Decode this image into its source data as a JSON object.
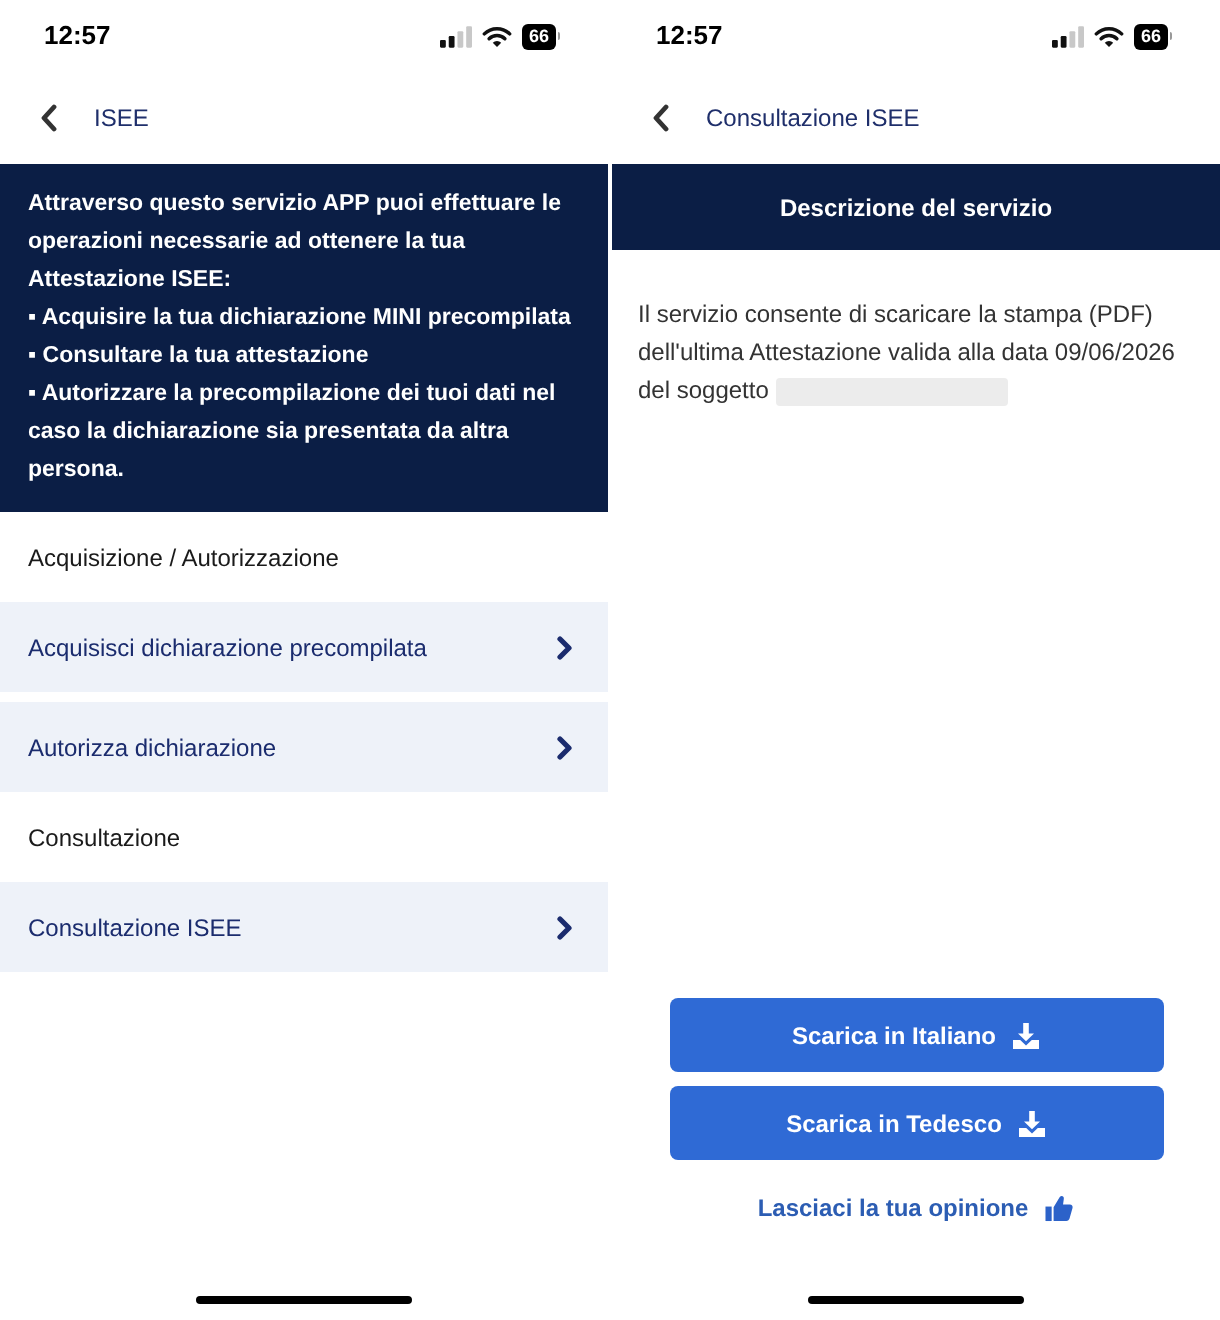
{
  "screens": [
    {
      "kind": "menu",
      "status_bar": {
        "time": "12:57",
        "battery": "66"
      },
      "header": {
        "title": "ISEE"
      },
      "intro": {
        "text": "Attraverso questo servizio APP puoi effettuare le operazioni necessarie ad ottenere la tua Attestazione ISEE:",
        "bullets": [
          "▪ Acquisire la tua dichiarazione MINI precompilata",
          "▪ Consultare la tua attestazione",
          "▪ Autorizzare la precompilazione dei tuoi dati nel caso la dichiarazione sia presentata da altra persona."
        ]
      },
      "sections": [
        {
          "title": "Acquisizione / Autorizzazione",
          "items": [
            {
              "label": "Acquisisci dichiarazione precompilata"
            },
            {
              "label": "Autorizza dichiarazione"
            }
          ]
        },
        {
          "title": "Consultazione",
          "items": [
            {
              "label": "Consultazione ISEE"
            }
          ]
        }
      ]
    },
    {
      "kind": "detail",
      "status_bar": {
        "time": "12:57",
        "battery": "66"
      },
      "header": {
        "title": "Consultazione ISEE"
      },
      "banner": {
        "title": "Descrizione del servizio"
      },
      "description": "Il servizio consente di scaricare la stampa (PDF) dell'ultima Attestazione valida alla data 09/06/2026 del soggetto",
      "buttons": [
        {
          "label": "Scarica in Italiano"
        },
        {
          "label": "Scarica in Tedesco"
        }
      ],
      "feedback_link": {
        "label": "Lasciaci la tua opinione"
      }
    }
  ]
}
